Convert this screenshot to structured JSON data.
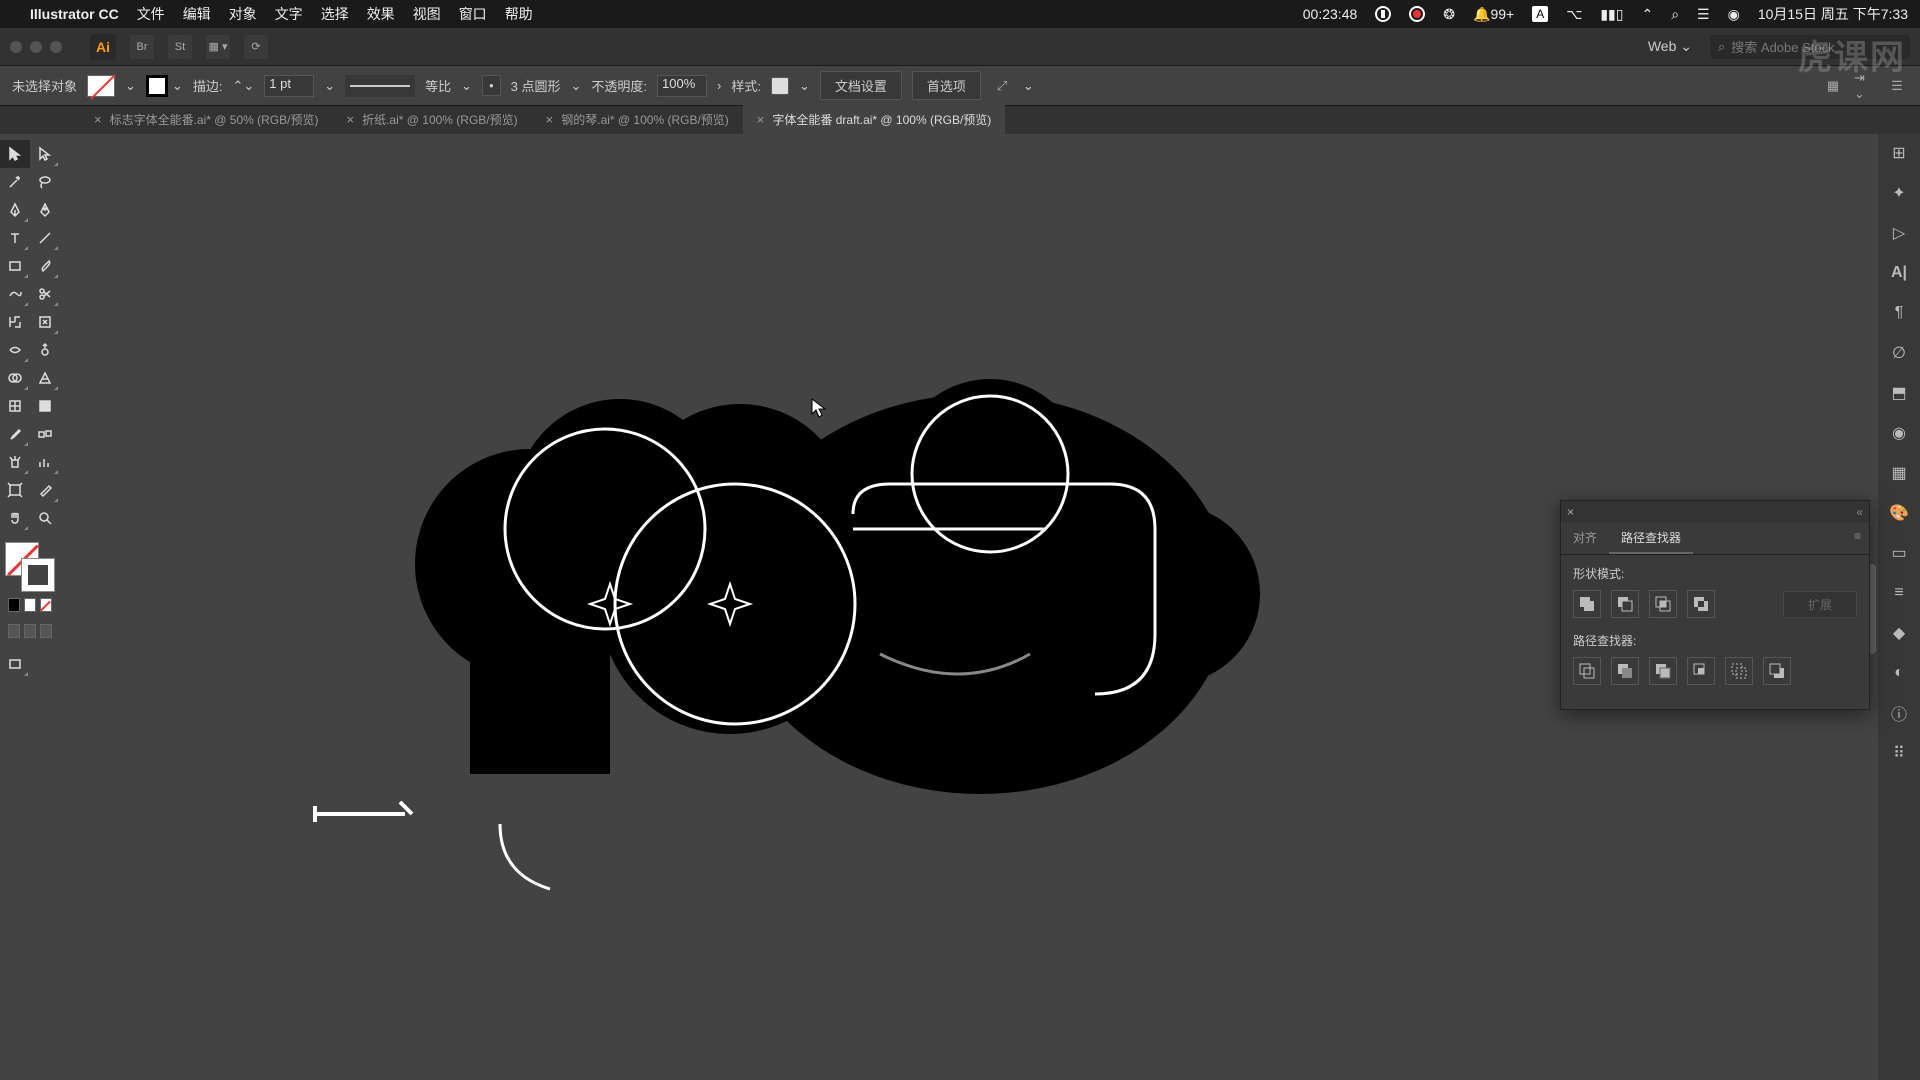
{
  "menubar": {
    "app": "Illustrator CC",
    "items": [
      "文件",
      "编辑",
      "对象",
      "文字",
      "选择",
      "效果",
      "视图",
      "窗口",
      "帮助"
    ],
    "timer": "00:23:48",
    "notif": "99+",
    "date": "10月15日 周五 下午7:33"
  },
  "app_top": {
    "profile": "Web",
    "search_placeholder": "搜索 Adobe Stock"
  },
  "ctrl": {
    "selection": "未选择对象",
    "stroke_label": "描边:",
    "stroke_weight": "1 pt",
    "profile": "等比",
    "brush": "3 点圆形",
    "opacity_label": "不透明度:",
    "opacity": "100%",
    "style_label": "样式:",
    "doc_setup": "文档设置",
    "prefs": "首选项"
  },
  "tabs": [
    {
      "label": "标志字体全能番.ai* @ 50% (RGB/预览)",
      "active": false
    },
    {
      "label": "折纸.ai* @ 100% (RGB/预览)",
      "active": false
    },
    {
      "label": "钢的琴.ai* @ 100% (RGB/预览)",
      "active": false
    },
    {
      "label": "字体全能番 draft.ai* @ 100% (RGB/预览)",
      "active": true
    }
  ],
  "panel": {
    "tab_align": "对齐",
    "tab_pathfinder": "路径查找器",
    "shape_modes": "形状模式:",
    "pathfinders": "路径查找器:",
    "expand": "扩展"
  },
  "watermark": "虎课网"
}
